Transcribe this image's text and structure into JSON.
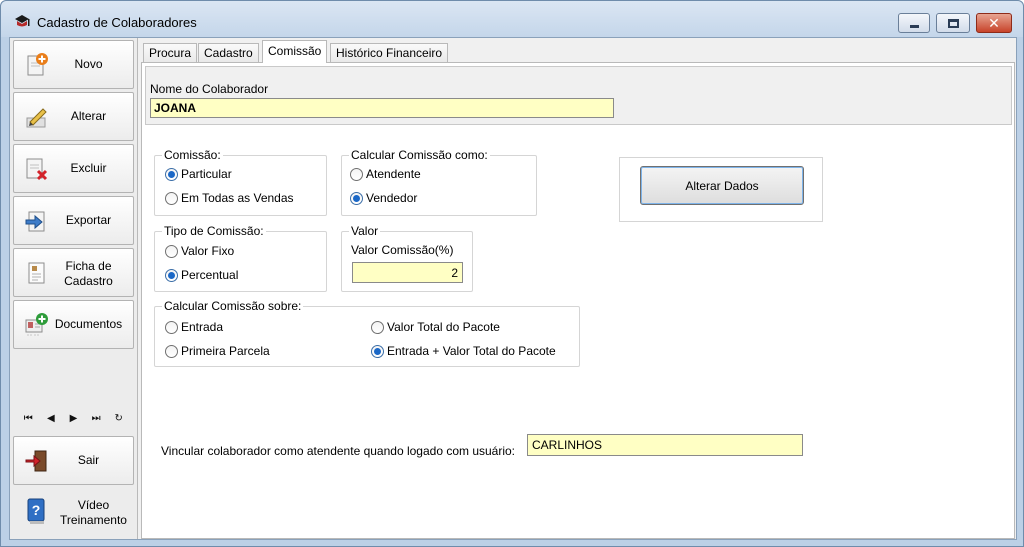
{
  "window": {
    "title": "Cadastro de Colaboradores"
  },
  "sidebar": {
    "novo": "Novo",
    "alterar": "Alterar",
    "excluir": "Excluir",
    "exportar": "Exportar",
    "ficha_line1": "Ficha de",
    "ficha_line2": "Cadastro",
    "documentos": "Documentos",
    "sair": "Sair",
    "video_line1": "Vídeo",
    "video_line2": "Treinamento",
    "nav": [
      "⏮",
      "◀",
      "▶",
      "⏭",
      "↻"
    ]
  },
  "tabs": [
    "Procura",
    "Cadastro",
    "Comissão",
    "Histórico Financeiro"
  ],
  "active_tab": "Comissão",
  "colaborador": {
    "label": "Nome do Colaborador",
    "value": "JOANA"
  },
  "comissao": {
    "title": "Comissão:",
    "options": [
      "Particular",
      "Em Todas as Vendas"
    ],
    "selected": "Particular"
  },
  "calcular_como": {
    "title": "Calcular Comissão como:",
    "options": [
      "Atendente",
      "Vendedor"
    ],
    "selected": "Vendedor"
  },
  "tipo": {
    "title": "Tipo de Comissão:",
    "options": [
      "Valor Fixo",
      "Percentual"
    ],
    "selected": "Percentual"
  },
  "valor": {
    "title": "Valor",
    "label": "Valor Comissão(%)",
    "value": "2"
  },
  "calcular_sobre": {
    "title": "Calcular Comissão sobre:",
    "options": [
      "Entrada",
      "Primeira Parcela",
      "Valor Total do Pacote",
      "Entrada + Valor Total do Pacote"
    ],
    "selected": "Entrada + Valor Total do Pacote"
  },
  "alterar_dados": "Alterar Dados",
  "vincular": {
    "label": "Vincular colaborador como atendente quando logado com usuário:",
    "value": "CARLINHOS"
  },
  "colors": {
    "field_bg": "#ffffc4",
    "radio_selected": "#1b68c7",
    "titlebar": "#c4d6ea",
    "close_button": "#c7432a"
  }
}
